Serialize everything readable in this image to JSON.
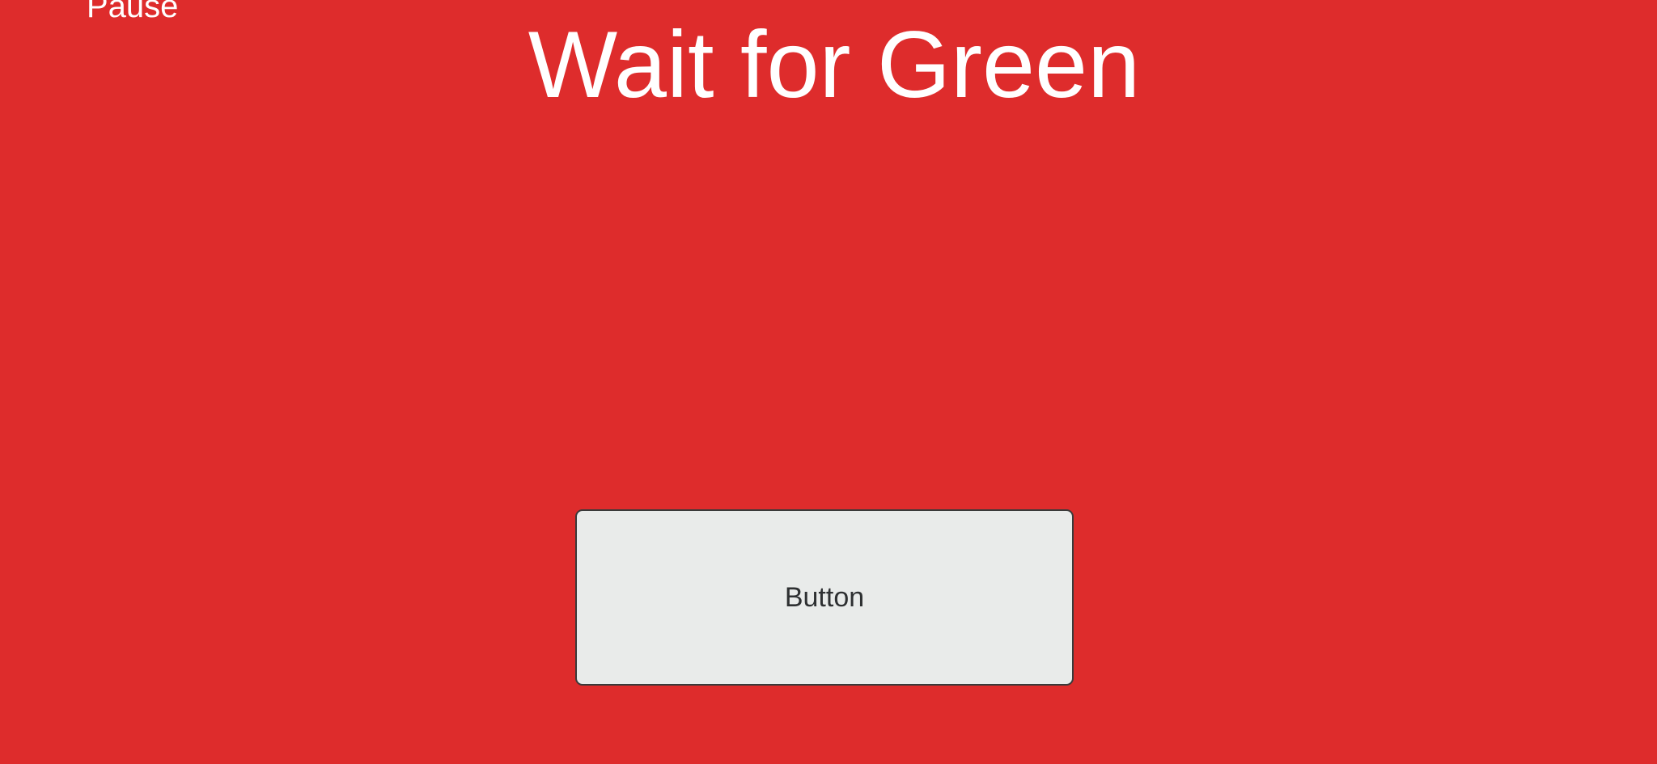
{
  "header": {
    "pause_label": "Pause",
    "title": "Wait for Green"
  },
  "main": {
    "button_label": "Button"
  },
  "colors": {
    "background": "#de2c2c",
    "title_text": "#ffffff",
    "button_fill": "#e9ebea",
    "button_border": "#3a3a3a",
    "button_text": "#2e3032"
  }
}
